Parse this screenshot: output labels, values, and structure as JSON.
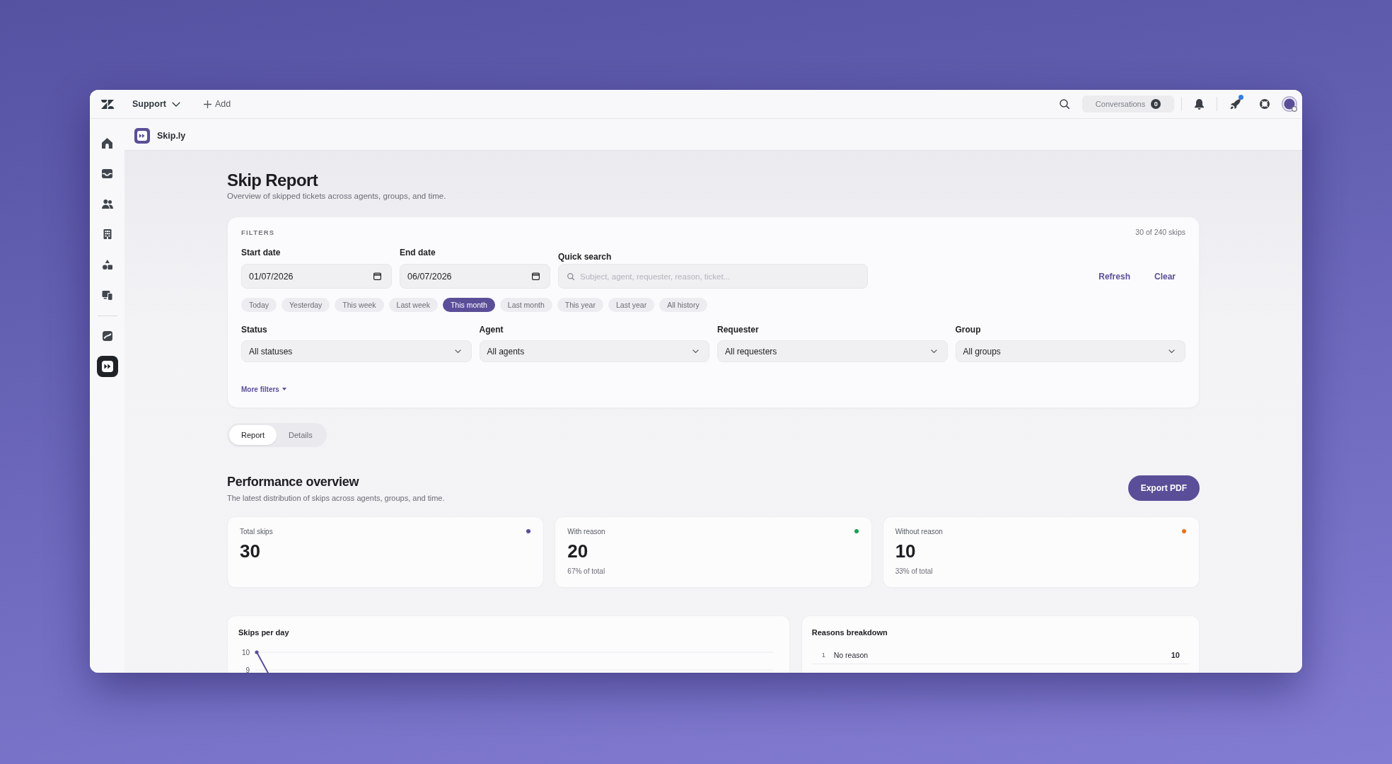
{
  "top_bar": {
    "workspace": "Support",
    "add_label": "Add",
    "conversations": {
      "label": "Conversations",
      "count": "0"
    },
    "updates_dot": true
  },
  "sidebar": {
    "items": [
      {
        "selected": false
      },
      {
        "selected": false
      },
      {
        "selected": false
      },
      {
        "selected": false
      },
      {
        "selected": false
      },
      {
        "selected": false
      },
      {
        "selected": false
      },
      {
        "selected": true
      }
    ]
  },
  "app_header": {
    "name": "Skip.ly"
  },
  "page": {
    "title": "Skip Report",
    "subtitle": "Overview of skipped tickets across agents, groups, and time."
  },
  "filters": {
    "heading": "FILTERS",
    "result_count": "30 of 240 skips",
    "start_date": {
      "label": "Start date",
      "value": "01/07/2026"
    },
    "end_date": {
      "label": "End date",
      "value": "06/07/2026"
    },
    "quick_search": {
      "label": "Quick search",
      "placeholder": "Subject, agent, requester, reason, ticket..."
    },
    "actions": [
      "Refresh",
      "Clear"
    ],
    "presets": [
      {
        "label": "Today",
        "selected": false
      },
      {
        "label": "Yesterday",
        "selected": false
      },
      {
        "label": "This week",
        "selected": false
      },
      {
        "label": "Last week",
        "selected": false
      },
      {
        "label": "This month",
        "selected": true
      },
      {
        "label": "Last month",
        "selected": false
      },
      {
        "label": "This year",
        "selected": false
      },
      {
        "label": "Last year",
        "selected": false
      },
      {
        "label": "All history",
        "selected": false
      }
    ],
    "selects": [
      {
        "label": "Status",
        "value": "All statuses"
      },
      {
        "label": "Agent",
        "value": "All agents"
      },
      {
        "label": "Requester",
        "value": "All requesters"
      },
      {
        "label": "Group",
        "value": "All groups"
      }
    ],
    "more_filters": "More filters"
  },
  "tabs": [
    {
      "label": "Report",
      "selected": true
    },
    {
      "label": "Details",
      "selected": false
    }
  ],
  "overview": {
    "title": "Performance overview",
    "subtitle": "The latest distribution of skips across agents, groups, and time.",
    "export_button": "Export PDF",
    "stats": [
      {
        "label": "Total skips",
        "value": "30",
        "color": "#5b4e98"
      },
      {
        "label": "With reason",
        "value": "20",
        "note": "67% of total",
        "color": "#1f9d55"
      },
      {
        "label": "Without reason",
        "value": "10",
        "note": "33% of total",
        "color": "#e8731c"
      }
    ]
  },
  "skips_per_day": {
    "title": "Skips per day",
    "axis_labels": [
      "10",
      "9"
    ]
  },
  "reasons_breakdown": {
    "title": "Reasons breakdown",
    "rows": [
      {
        "rank": "1",
        "reason": "No reason",
        "count": "10"
      }
    ]
  }
}
